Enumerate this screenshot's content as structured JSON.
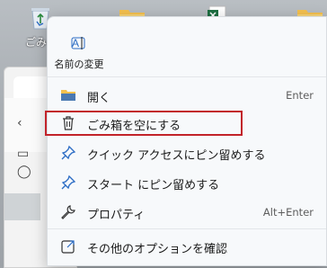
{
  "desktop": {
    "recycle_label": "ごみ",
    "icons": [
      "recycle-bin-icon",
      "folder-icon",
      "excel-file-icon",
      "folder-icon"
    ]
  },
  "context_menu": {
    "quick_actions": {
      "rename_label": "名前の変更",
      "rename_icon": "rename-icon"
    },
    "items": [
      {
        "label": "開く",
        "shortcut": "Enter",
        "icon": "folder-open-icon"
      },
      {
        "label": "ごみ箱を空にする",
        "shortcut": "",
        "icon": "trash-icon",
        "highlighted": true
      },
      {
        "label": "クイック アクセスにピン留めする",
        "shortcut": "",
        "icon": "pin-icon"
      },
      {
        "label": "スタート にピン留めする",
        "shortcut": "",
        "icon": "pin-icon"
      },
      {
        "label": "プロパティ",
        "shortcut": "Alt+Enter",
        "icon": "wrench-icon"
      },
      {
        "label": "その他のオプションを確認",
        "shortcut": "",
        "icon": "external-options-icon"
      }
    ]
  },
  "colors": {
    "highlight_border": "#c2232a",
    "menu_bg": "#f7f9fb",
    "pin_blue": "#2b6cc4",
    "folder_yellow": "#f4c04e"
  }
}
